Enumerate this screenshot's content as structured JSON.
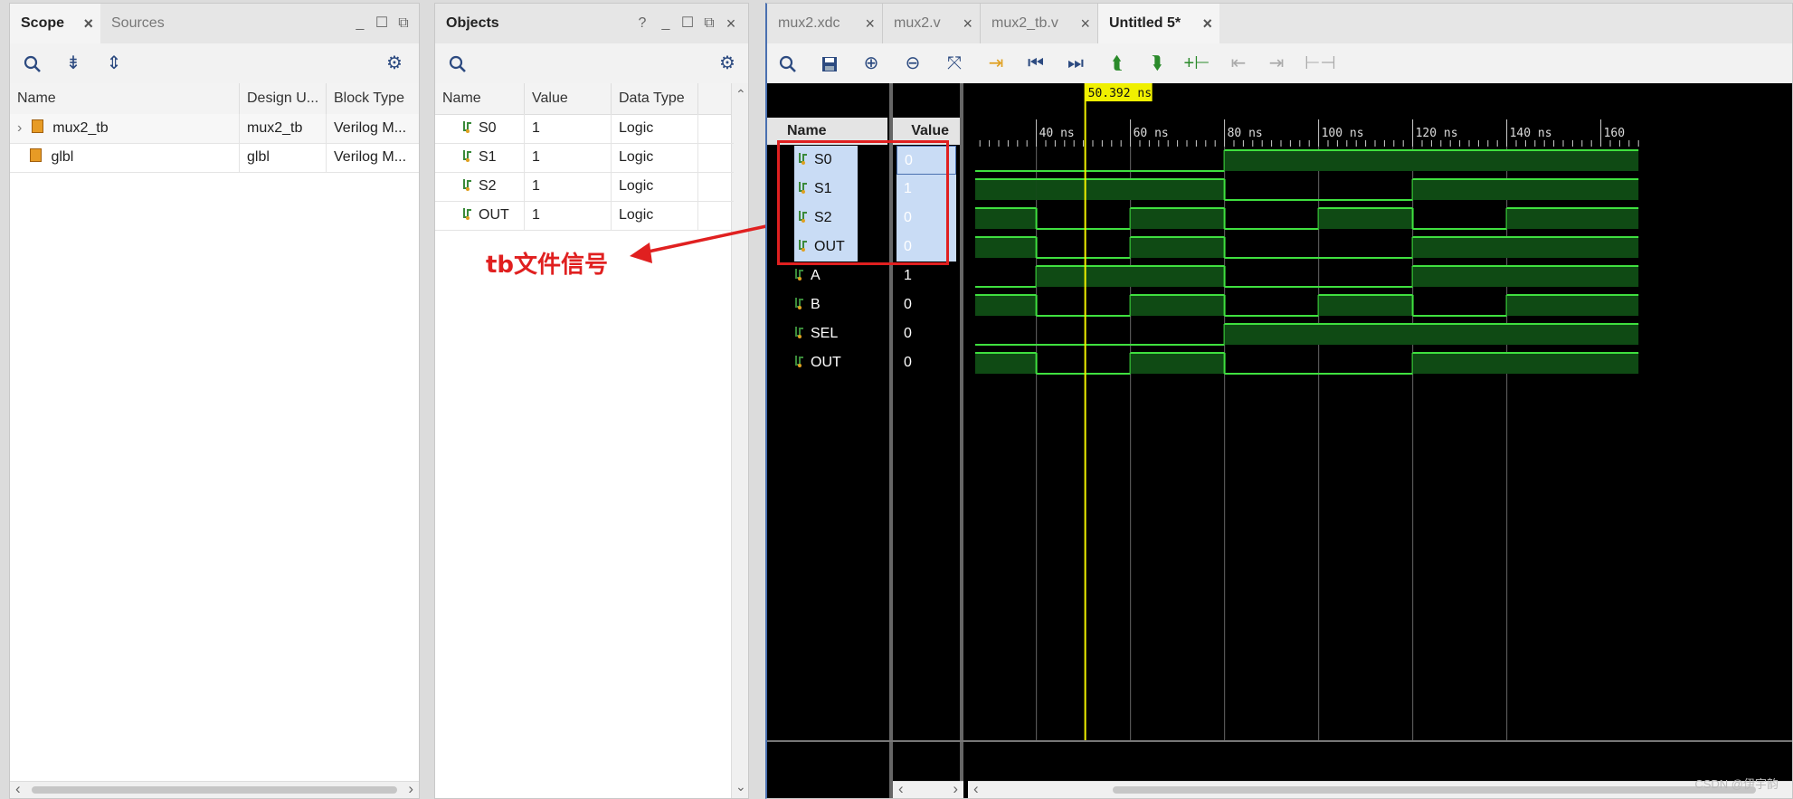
{
  "scope_panel": {
    "tabs": [
      {
        "label": "Scope"
      },
      {
        "label": "Sources"
      }
    ],
    "columns": [
      "Name",
      "Design U...",
      "Block Type"
    ],
    "rows": [
      {
        "name": "mux2_tb",
        "design_unit": "mux2_tb",
        "block_type": "Verilog M..."
      },
      {
        "name": "glbl",
        "design_unit": "glbl",
        "block_type": "Verilog M..."
      }
    ]
  },
  "objects_panel": {
    "title": "Objects",
    "help": "?",
    "columns": [
      "Name",
      "Value",
      "Data Type"
    ],
    "rows": [
      {
        "name": "S0",
        "value": "1",
        "type": "Logic"
      },
      {
        "name": "S1",
        "value": "1",
        "type": "Logic"
      },
      {
        "name": "S2",
        "value": "1",
        "type": "Logic"
      },
      {
        "name": "OUT",
        "value": "1",
        "type": "Logic"
      }
    ]
  },
  "annotation": {
    "text": "tb文件信号",
    "color": "#e02020"
  },
  "editor_tabs": [
    {
      "label": "mux2.xdc"
    },
    {
      "label": "mux2.v"
    },
    {
      "label": "mux2_tb.v"
    },
    {
      "label": "Untitled 5*"
    }
  ],
  "wave_panel": {
    "name_header": "Name",
    "value_header": "Value",
    "cursor_label": "50.392 ns",
    "time_ticks": [
      "40 ns",
      "60 ns",
      "80 ns",
      "100 ns",
      "120 ns",
      "140 ns",
      "160"
    ],
    "signals": [
      {
        "name": "S0",
        "value": "0",
        "kind": "tb"
      },
      {
        "name": "S1",
        "value": "1",
        "kind": "tb"
      },
      {
        "name": "S2",
        "value": "0",
        "kind": "tb"
      },
      {
        "name": "OUT",
        "value": "0",
        "kind": "tb"
      },
      {
        "name": "A",
        "value": "1",
        "kind": "dut"
      },
      {
        "name": "B",
        "value": "0",
        "kind": "dut"
      },
      {
        "name": "SEL",
        "value": "0",
        "kind": "dut"
      },
      {
        "name": "OUT",
        "value": "0",
        "kind": "dut"
      }
    ],
    "waveforms": {
      "time_range_ns": [
        27,
        168
      ],
      "cursor_ns": 50.392,
      "series": [
        {
          "name": "S0",
          "levels": [
            [
              27,
              0
            ],
            [
              80,
              1
            ],
            [
              168,
              1
            ]
          ]
        },
        {
          "name": "S1",
          "levels": [
            [
              27,
              1
            ],
            [
              40,
              1
            ],
            [
              80,
              0
            ],
            [
              120,
              1
            ],
            [
              168,
              1
            ]
          ]
        },
        {
          "name": "S2",
          "levels": [
            [
              27,
              1
            ],
            [
              40,
              0
            ],
            [
              60,
              1
            ],
            [
              80,
              0
            ],
            [
              100,
              1
            ],
            [
              120,
              0
            ],
            [
              140,
              1
            ],
            [
              168,
              1
            ]
          ]
        },
        {
          "name": "OUT",
          "levels": [
            [
              27,
              1
            ],
            [
              40,
              0
            ],
            [
              60,
              1
            ],
            [
              80,
              0
            ],
            [
              120,
              1
            ],
            [
              168,
              1
            ]
          ]
        },
        {
          "name": "A",
          "levels": [
            [
              27,
              0
            ],
            [
              40,
              1
            ],
            [
              80,
              0
            ],
            [
              120,
              1
            ],
            [
              168,
              1
            ]
          ]
        },
        {
          "name": "B",
          "levels": [
            [
              27,
              1
            ],
            [
              40,
              0
            ],
            [
              60,
              1
            ],
            [
              80,
              0
            ],
            [
              100,
              1
            ],
            [
              120,
              0
            ],
            [
              140,
              1
            ],
            [
              168,
              1
            ]
          ]
        },
        {
          "name": "SEL",
          "levels": [
            [
              27,
              0
            ],
            [
              80,
              1
            ],
            [
              168,
              1
            ]
          ]
        },
        {
          "name": "OUT",
          "levels": [
            [
              27,
              1
            ],
            [
              40,
              0
            ],
            [
              60,
              1
            ],
            [
              80,
              0
            ],
            [
              120,
              1
            ],
            [
              168,
              1
            ]
          ]
        }
      ]
    }
  },
  "watermark": "CSDN @伊宇韵",
  "colors": {
    "wave_line": "#3fe03f",
    "wave_fill": "#0f4a14",
    "cursor": "#f0f000",
    "selection": "#c9dcf5",
    "accent": "#2c4a80"
  }
}
